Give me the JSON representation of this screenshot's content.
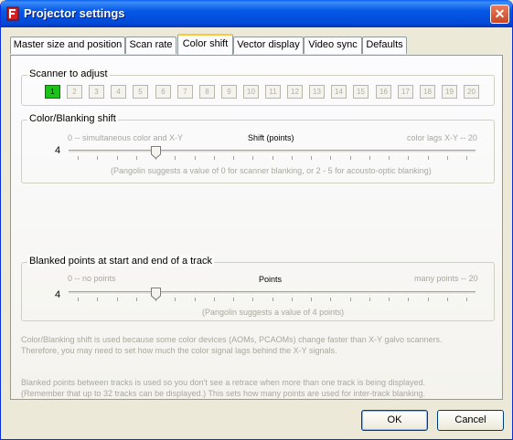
{
  "window": {
    "title": "Projector settings",
    "close_glyph": "✕"
  },
  "tabs": [
    {
      "label": "Master size and position",
      "active": false
    },
    {
      "label": "Scan rate",
      "active": false
    },
    {
      "label": "Color shift",
      "active": true
    },
    {
      "label": "Vector display",
      "active": false
    },
    {
      "label": "Video sync",
      "active": false
    },
    {
      "label": "Defaults",
      "active": false
    }
  ],
  "scanner": {
    "legend": "Scanner to adjust",
    "buttons": [
      "1",
      "2",
      "3",
      "4",
      "5",
      "6",
      "7",
      "8",
      "9",
      "10",
      "11",
      "12",
      "13",
      "14",
      "15",
      "16",
      "17",
      "18",
      "19",
      "20"
    ],
    "selected": "1"
  },
  "color_shift": {
    "legend": "Color/Blanking shift",
    "min_label": "0 -- simultaneous color and X-Y",
    "center_label": "Shift (points)",
    "max_label": "color lags X-Y -- 20",
    "value": "4",
    "slider_value": 4,
    "slider_max": 20,
    "suggestion": "(Pangolin suggests a value of 0 for scanner blanking, or 2 - 5 for acousto-optic blanking)"
  },
  "blanked_points": {
    "legend": "Blanked points at start and end of a track",
    "min_label": "0 -- no points",
    "center_label": "Points",
    "max_label": "many points -- 20",
    "value": "4",
    "slider_value": 4,
    "slider_max": 20,
    "suggestion": "(Pangolin suggests a value of 4 points)"
  },
  "notes": {
    "line1": "Color/Blanking shift is used because some color devices (AOMs, PCAOMs) change faster than X-Y galvo scanners.",
    "line2": "Therefore, you may need to set how much the color signal lags behind the X-Y signals.",
    "line3": "Blanked points between tracks is used so you don't see a retrace when more than one track is being displayed.",
    "line4": "(Remember that up to 32 tracks can be displayed.) This sets how many points are used for inter-track blanking."
  },
  "footer": {
    "ok_label": "OK",
    "cancel_label": "Cancel"
  },
  "colors": {
    "title_blue": "#0558e6",
    "selected_green": "#1cc21a",
    "tab_highlight": "#ffc83c"
  }
}
